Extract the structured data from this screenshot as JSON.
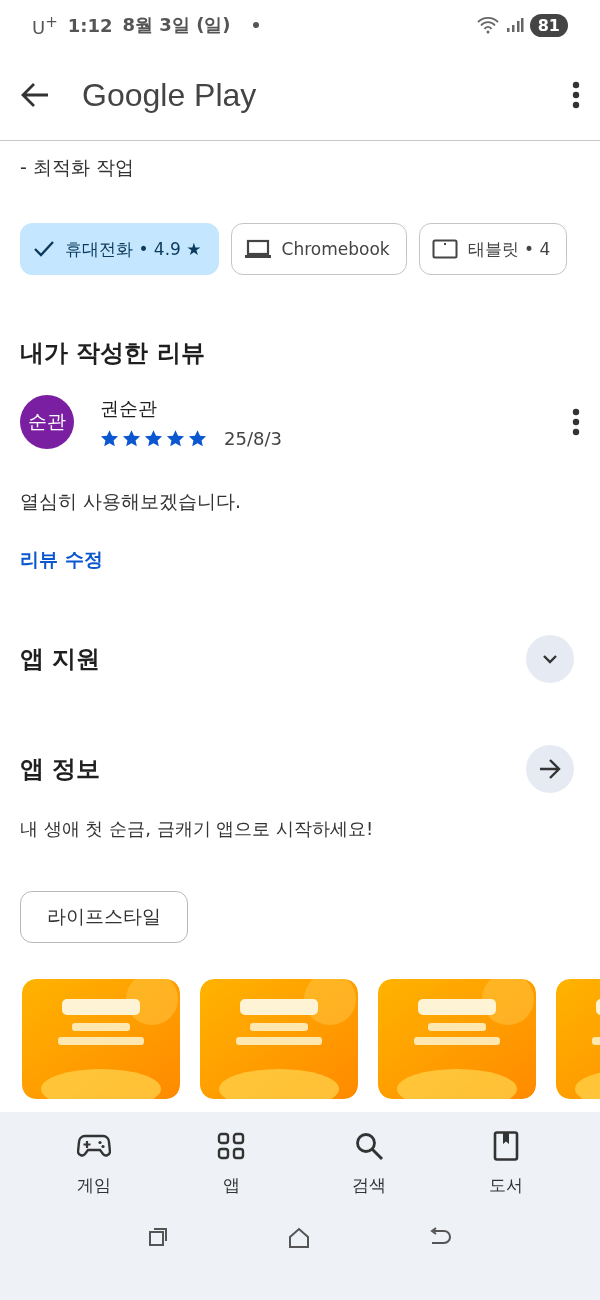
{
  "status_bar": {
    "carrier": "U",
    "carrier_sup": "+",
    "time": "1:12",
    "date": "8월 3일 (일)",
    "battery": "81"
  },
  "header": {
    "title": "Google Play"
  },
  "release_note": "- 최적화 작업",
  "devices": [
    {
      "label": "휴대전화 • 4.9 ★",
      "selected": true
    },
    {
      "kind": "laptop",
      "label": "Chromebook",
      "selected": false
    },
    {
      "kind": "tablet",
      "label": "태블릿 • 4",
      "selected": false
    }
  ],
  "my_review": {
    "heading": "내가 작성한 리뷰",
    "avatar": "순관",
    "author": "권순관",
    "stars": 5,
    "date": "25/8/3",
    "text": "열심히 사용해보겠습니다.",
    "edit_link": "리뷰 수정"
  },
  "support": {
    "title": "앱 지원"
  },
  "about": {
    "title": "앱 정보",
    "description": "내 생애 첫 순금, 금캐기 앱으로 시작하세요!",
    "category": "라이프스타일"
  },
  "bottom_nav": [
    {
      "kind": "games",
      "label": "게임"
    },
    {
      "kind": "apps",
      "label": "앱"
    },
    {
      "kind": "search",
      "label": "검색"
    },
    {
      "kind": "books",
      "label": "도서"
    }
  ]
}
